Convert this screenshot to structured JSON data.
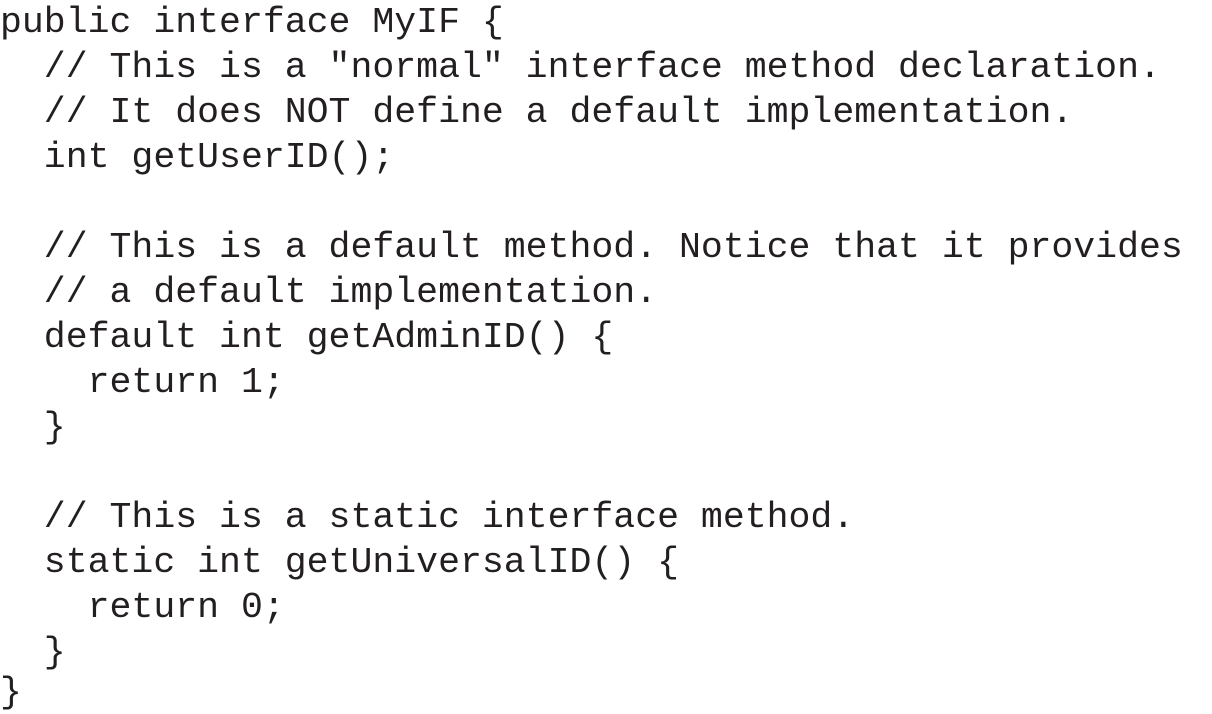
{
  "code": {
    "lines": [
      "public interface MyIF {",
      "  // This is a \"normal\" interface method declaration.",
      "  // It does NOT define a default implementation.",
      "  int getUserID();",
      "",
      "  // This is a default method. Notice that it provides",
      "  // a default implementation.",
      "  default int getAdminID() {",
      "    return 1;",
      "  }",
      "",
      "  // This is a static interface method.",
      "  static int getUniversalID() {",
      "    return 0;",
      "  }",
      "}"
    ]
  }
}
